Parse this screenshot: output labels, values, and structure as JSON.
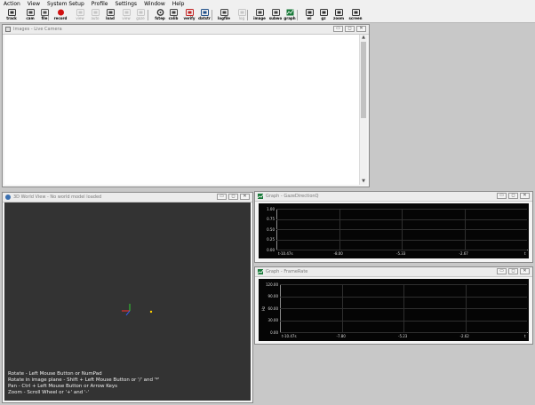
{
  "menu": [
    "Action",
    "View",
    "System Setup",
    "Profile",
    "Settings",
    "Window",
    "Help"
  ],
  "toolbar": [
    {
      "label": "track",
      "icon": "target-icon",
      "enabled": true
    },
    {
      "label": "cam",
      "icon": "camera-icon",
      "enabled": true
    },
    {
      "label": "file",
      "icon": "file-icon",
      "enabled": true
    },
    {
      "label": "record",
      "icon": "record-icon",
      "enabled": true
    },
    {
      "label": "view",
      "icon": "view-icon",
      "enabled": false
    },
    {
      "label": "auto",
      "icon": "auto-icon",
      "enabled": false
    },
    {
      "label": "load",
      "icon": "load-icon",
      "enabled": true
    },
    {
      "label": "view",
      "icon": "view2-icon",
      "enabled": false
    },
    {
      "label": "gaze",
      "icon": "gaze-icon",
      "enabled": false
    },
    {
      "label": "fstep",
      "icon": "gear-icon",
      "enabled": true
    },
    {
      "label": "calib",
      "icon": "calib-icon",
      "enabled": true
    },
    {
      "label": "verify",
      "icon": "verify-icon",
      "enabled": true
    },
    {
      "label": "datstr",
      "icon": "data-stream-icon",
      "enabled": true
    },
    {
      "label": "logfile",
      "icon": "logfile-icon",
      "enabled": true
    },
    {
      "label": "log",
      "icon": "log-icon",
      "enabled": false
    },
    {
      "label": "image",
      "icon": "image-icon",
      "enabled": true
    },
    {
      "label": "subwo",
      "icon": "subwo-icon",
      "enabled": true
    },
    {
      "label": "graph",
      "icon": "graph-icon",
      "enabled": true
    },
    {
      "label": "wi",
      "icon": "world-icon",
      "enabled": true
    },
    {
      "label": "gz",
      "icon": "gz-icon",
      "enabled": true
    },
    {
      "label": "zoom",
      "icon": "zoom-icon",
      "enabled": true
    },
    {
      "label": "screen",
      "icon": "screen-icon",
      "enabled": true
    }
  ],
  "windows": {
    "images": {
      "title": "Images - Live Camera"
    },
    "world": {
      "title": "3D World View - No world model loaded",
      "hints": [
        "Rotate - Left Mouse Button or NumPad",
        "Rotate in image plane - Shift + Left Mouse Button or '/' and '*'",
        "Pan - Ctrl + Left Mouse Button or Arrow Keys",
        "Zoom - Scroll Wheel or '+' and '-'"
      ]
    },
    "graph1": {
      "title": "Graph - GazeDirectionQ",
      "yticks": [
        "1.00",
        "0.75",
        "0.50",
        "0.25",
        "0.00"
      ],
      "xticks": [
        "t-10.47s",
        "-8.00",
        "-5.33",
        "-2.67",
        "t"
      ]
    },
    "graph2": {
      "title": "Graph - FrameRate",
      "ylabel": "Hz",
      "yticks": [
        "120.00",
        "90.00",
        "60.00",
        "30.00",
        "0.00"
      ],
      "xticks": [
        "t-10.47s",
        "-7.80",
        "-5.23",
        "-2.62",
        "t"
      ]
    }
  },
  "colors": {
    "axis_x": "#ff3030",
    "axis_y": "#30d030",
    "axis_z": "#3060ff",
    "origin": "#ffd000"
  }
}
